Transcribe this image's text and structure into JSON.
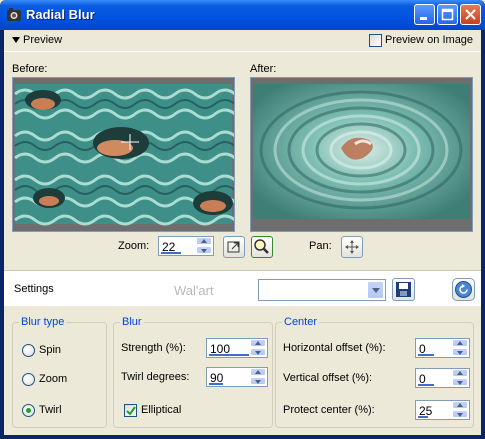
{
  "window": {
    "title": "Radial Blur"
  },
  "preview": {
    "toggle_label": "Preview",
    "preview_on_image_label": "Preview on Image",
    "preview_on_image_checked": false,
    "before_label": "Before:",
    "after_label": "After:",
    "zoom_label": "Zoom:",
    "zoom_value": "22",
    "pan_label": "Pan:"
  },
  "settings": {
    "label": "Settings",
    "watermark": "Wal'art",
    "preset_value": ""
  },
  "blur_type": {
    "label": "Blur type",
    "options": [
      {
        "label": "Spin",
        "selected": false
      },
      {
        "label": "Zoom",
        "selected": false
      },
      {
        "label": "Twirl",
        "selected": true
      }
    ]
  },
  "blur": {
    "label": "Blur",
    "strength_label": "Strength (%):",
    "strength_value": "100",
    "twirl_label": "Twirl degrees:",
    "twirl_value": "90",
    "elliptical_label": "Elliptical",
    "elliptical_checked": true
  },
  "center": {
    "label": "Center",
    "h_offset_label": "Horizontal offset (%):",
    "h_offset_value": "0",
    "v_offset_label": "Vertical offset (%):",
    "v_offset_value": "0",
    "protect_label": "Protect center (%):",
    "protect_value": "25"
  },
  "colors": {
    "accent": "#0046D5",
    "title_bar": "#0053E1",
    "image_teal": "#5FB3A8"
  }
}
